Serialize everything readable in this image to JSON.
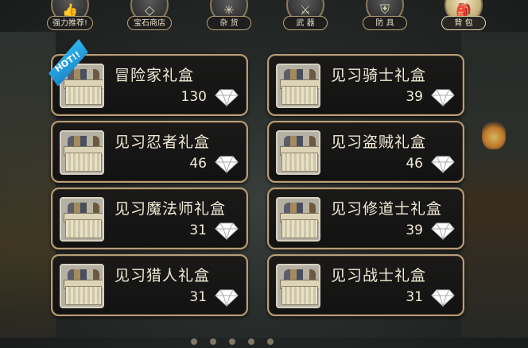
{
  "tabs": [
    {
      "label": "强力推荐!",
      "icon": "recommend-icon",
      "active": false
    },
    {
      "label": "宝石商店",
      "icon": "gem-shop-icon",
      "active": false
    },
    {
      "label": "杂 货",
      "icon": "compass-icon",
      "active": false
    },
    {
      "label": "武 器",
      "icon": "sword-icon",
      "active": false
    },
    {
      "label": "防 具",
      "icon": "armor-icon",
      "active": false
    },
    {
      "label": "背 包",
      "icon": "bag-icon",
      "active": true
    }
  ],
  "badge": {
    "hot": "HOT!!"
  },
  "items": [
    {
      "name": "冒险家礼盒",
      "price": "130"
    },
    {
      "name": "见习骑士礼盒",
      "price": "39"
    },
    {
      "name": "见习忍者礼盒",
      "price": "46"
    },
    {
      "name": "见习盗贼礼盒",
      "price": "46"
    },
    {
      "name": "见习魔法师礼盒",
      "price": "31"
    },
    {
      "name": "见习修道士礼盒",
      "price": "39"
    },
    {
      "name": "见习猎人礼盒",
      "price": "31"
    },
    {
      "name": "见习战士礼盒",
      "price": "31"
    }
  ],
  "colors": {
    "card_border": "#b99e76",
    "hot_badge": "#2fb6f0",
    "text": "#f1ead8"
  }
}
